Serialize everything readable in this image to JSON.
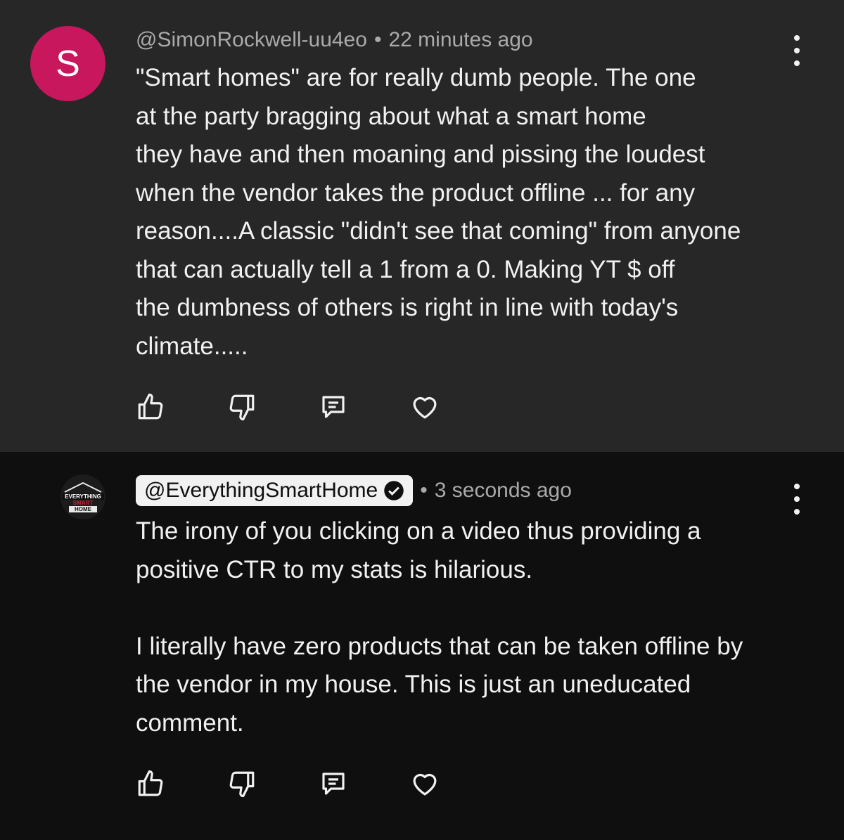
{
  "comments": [
    {
      "avatar_letter": "S",
      "avatar_color": "#c8175d",
      "handle": "@SimonRockwell-uu4eo",
      "time": "22 minutes ago",
      "text": "\"Smart homes\" are for really dumb people.  The one\nat the party bragging about what a smart home\nthey have and then moaning and pissing the loudest\nwhen the vendor takes the product offline ... for any\nreason....A classic \"didn't see that coming\" from anyone\nthat can actually tell a 1 from a 0.  Making YT $ off\nthe dumbness of others is right in line with today's\nclimate....."
    },
    {
      "avatar_logo": {
        "line1": "EVERYTHING",
        "line2": "SMART",
        "line3": "HOME"
      },
      "handle": "@EverythingSmartHome",
      "verified": true,
      "time": "3 seconds ago",
      "text": "The irony of you clicking on a video thus providing a\npositive CTR to my stats is hilarious.\n\nI literally have zero products that can be taken offline by\nthe vendor in my house. This is just an uneducated\ncomment."
    }
  ],
  "actions": [
    "thumbs-up-icon",
    "thumbs-down-icon",
    "reply-icon",
    "heart-icon"
  ],
  "separator": "•"
}
